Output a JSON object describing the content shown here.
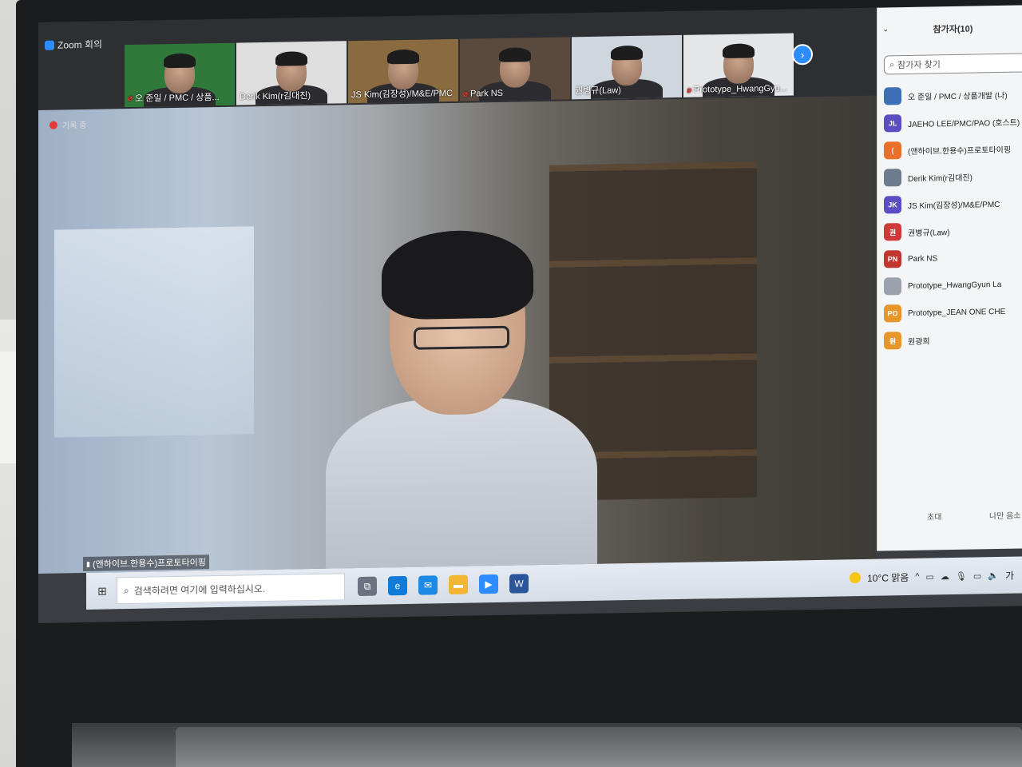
{
  "window": {
    "title": "Zoom 회의"
  },
  "recording": {
    "label": "기록 중"
  },
  "thumbnails": [
    {
      "name": "오 준일 / PMC / 상품...",
      "muted": true,
      "bg": "#2f7a3a"
    },
    {
      "name": "Derik Kim(r김대진)",
      "muted": false,
      "bg": "#dedede"
    },
    {
      "name": "JS Kim(김장성)/M&E/PMC",
      "muted": false,
      "bg": "#8a6b3f"
    },
    {
      "name": "Park NS",
      "muted": true,
      "bg": "#5a4a3e"
    },
    {
      "name": "권병규(Law)",
      "muted": false,
      "bg": "#cfd6dd"
    },
    {
      "name": "Prototype_HwangGyu...",
      "muted": true,
      "bg": "#e4e6e8"
    }
  ],
  "main_video": {
    "name": "(앤하이브.한용수)프로토타이핑"
  },
  "panel": {
    "title": "참가자(10)",
    "search_placeholder": "참가자 찾기",
    "participants": [
      {
        "initials": "",
        "name": "오 준일 / PMC / 상품개발 (나)",
        "color": "#3b6fb6",
        "icon": "photo-avatar"
      },
      {
        "initials": "JL",
        "name": "JAEHO LEE/PMC/PAO (호스트)",
        "color": "#5b4ec2"
      },
      {
        "initials": "(",
        "name": "(앤하이브.한용수)프로토타이핑",
        "color": "#e8702a"
      },
      {
        "initials": "",
        "name": "Derik Kim(r김대진)",
        "color": "#6d7c8c",
        "icon": "photo-avatar"
      },
      {
        "initials": "JK",
        "name": "JS Kim(김장성)/M&E/PMC",
        "color": "#5b4ec2"
      },
      {
        "initials": "권",
        "name": "권병규(Law)",
        "color": "#d0393a"
      },
      {
        "initials": "PN",
        "name": "Park NS",
        "color": "#c3352f"
      },
      {
        "initials": "",
        "name": "Prototype_HwangGyun La",
        "color": "#9aa3ad",
        "icon": "photo-avatar"
      },
      {
        "initials": "PO",
        "name": "Prototype_JEAN ONE CHE",
        "color": "#e8952a"
      },
      {
        "initials": "원",
        "name": "원광희",
        "color": "#e8952a"
      }
    ],
    "invite_label": "초대",
    "mute_self_label": "나만 음소"
  },
  "taskbar": {
    "search_placeholder": "검색하려면 여기에 입력하십시오.",
    "weather": "10°C 맑음",
    "lang": "가",
    "apps": [
      {
        "name": "task-view-icon",
        "color": "#6b7380",
        "glyph": "⧉"
      },
      {
        "name": "edge-icon",
        "color": "#0f7bd6",
        "glyph": "e"
      },
      {
        "name": "mail-icon",
        "color": "#1e88e5",
        "glyph": "✉"
      },
      {
        "name": "file-explorer-icon",
        "color": "#f2b632",
        "glyph": "▬"
      },
      {
        "name": "zoom-icon",
        "color": "#2d8cff",
        "glyph": "▶"
      },
      {
        "name": "word-icon",
        "color": "#2b579a",
        "glyph": "W"
      }
    ]
  }
}
